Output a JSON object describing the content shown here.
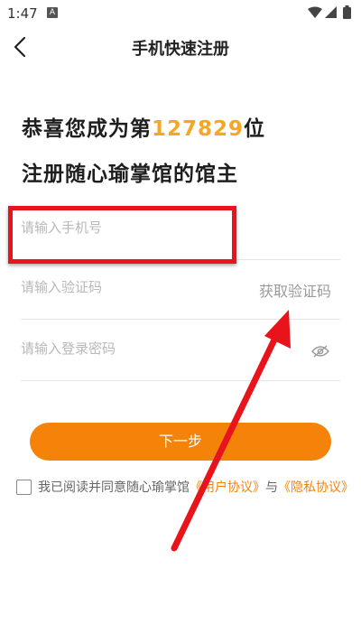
{
  "status_bar": {
    "time": "1:47",
    "notification_badge": "A"
  },
  "nav": {
    "title": "手机快速注册",
    "back_icon": "chevron-left-icon"
  },
  "headline": {
    "line1_prefix": "恭喜您成为第",
    "member_number": "127829",
    "line1_suffix": "位",
    "line2": "注册随心瑜掌馆的馆主"
  },
  "form": {
    "phone_placeholder": "请输入手机号",
    "code_placeholder": "请输入验证码",
    "get_code_label": "获取验证码",
    "password_placeholder": "请输入登录密码",
    "password_toggle_icon": "eye-off-icon",
    "next_label": "下一步"
  },
  "agreement": {
    "prefix": "我已阅读并同意随心瑜掌馆",
    "user_agreement": "《用户协议》",
    "conjunction": "与",
    "privacy_agreement": "《隐私协议》"
  },
  "colors": {
    "accent": "#F5830A",
    "number_highlight": "#F5A623",
    "annotation": "#E8131B"
  }
}
